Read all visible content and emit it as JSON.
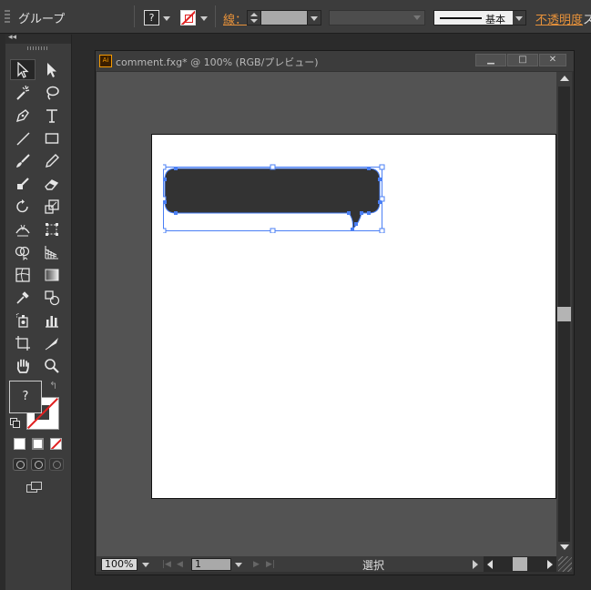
{
  "control_bar": {
    "selection_type": "グループ",
    "fill_swatch": "?",
    "stroke_label": "線：",
    "stroke_weight": "",
    "brush_definition": "基本",
    "opacity_label": "不透明度",
    "style_label_partial": "ス"
  },
  "tools_panel": {
    "collapse": "◂◂",
    "fill_unknown": "?",
    "swap_symbol": "↰"
  },
  "document": {
    "title": "comment.fxg* @ 100% (RGB/プレビュー)",
    "window_buttons": {
      "minimize": "▁",
      "maximize": "□",
      "close": "✕"
    },
    "ai_icon": "Ai",
    "zoom": "100%",
    "page": "1",
    "status_text": "選択"
  },
  "colors": {
    "accent": "#e8923a",
    "selection": "#4a7ff5",
    "bubble_fill": "#333333",
    "panel_bg": "#3c3c3c",
    "canvas_bg": "#535353"
  }
}
